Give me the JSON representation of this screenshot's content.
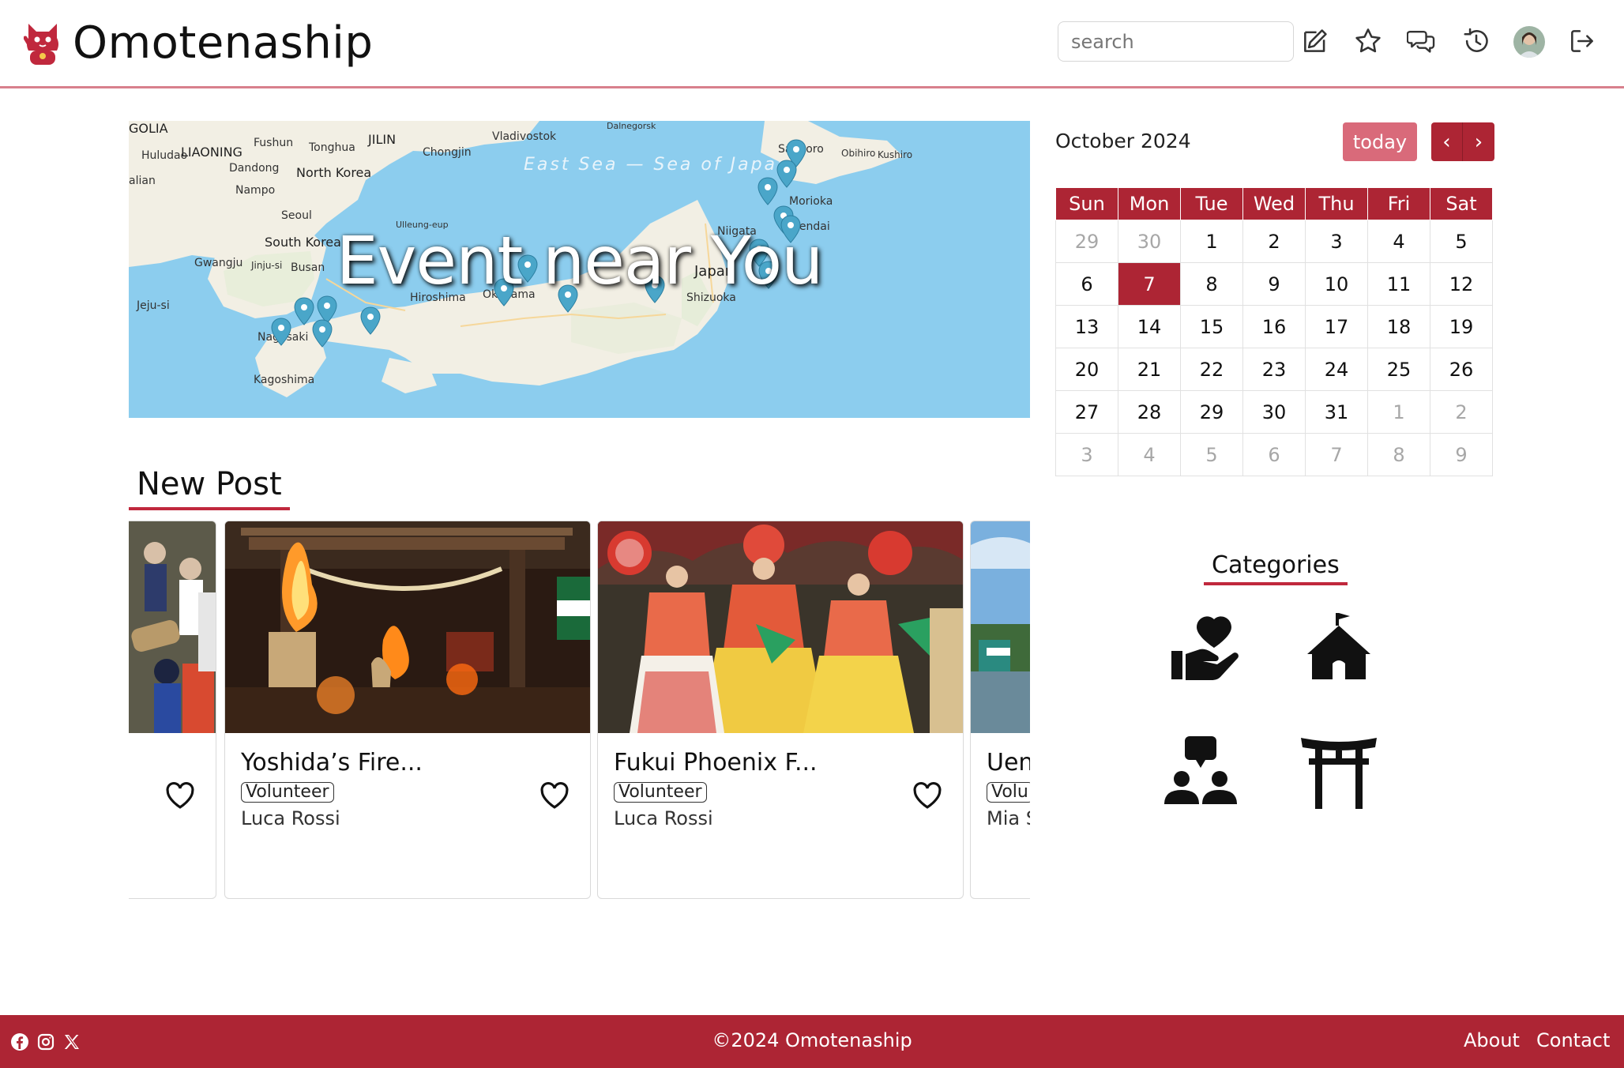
{
  "header": {
    "brand_name": "Omotenaship",
    "search_placeholder": "search",
    "icons": [
      "edit-icon",
      "star-icon",
      "chat-icon",
      "history-icon",
      "avatar",
      "logout-icon"
    ]
  },
  "map": {
    "title": "Event near You",
    "labels": [
      "GOLIA",
      "LIAONING",
      "JILIN",
      "Fushun",
      "Tonghua",
      "Vladivostok",
      "Huludao",
      "Dandong",
      "Chongjin",
      "Dalnegorsk",
      "North Korea",
      "Nampo",
      "Seoul",
      "Ulleung-eup",
      "South Korea",
      "Gwangju",
      "Jinju-si",
      "Busan",
      "Jeju-si",
      "Hiroshima",
      "Okayama",
      "Nagasaki",
      "Kagoshima",
      "Niigata",
      "Sendai",
      "Morioka",
      "Sapporo",
      "Obihiro",
      "Kushiro",
      "Shizuoka",
      "Japan",
      "alian"
    ],
    "sea_label": "East Sea — Sea of Japan"
  },
  "new_post": {
    "title": "New Post",
    "cards": [
      {
        "title": "",
        "tag": "",
        "author": ""
      },
      {
        "title": "Yoshida’s Fire...",
        "tag": "Volunteer",
        "author": "Luca Rossi"
      },
      {
        "title": "Fukui Phoenix F...",
        "tag": "Volunteer",
        "author": "Luca Rossi"
      },
      {
        "title": "Uen",
        "tag": "Volu",
        "author": "Mia S"
      }
    ]
  },
  "calendar": {
    "title": "October 2024",
    "today_label": "today",
    "prev_label": "‹",
    "next_label": "›",
    "weekdays": [
      "Sun",
      "Mon",
      "Tue",
      "Wed",
      "Thu",
      "Fri",
      "Sat"
    ],
    "weeks": [
      [
        "29",
        "30",
        "1",
        "2",
        "3",
        "4",
        "5"
      ],
      [
        "6",
        "7",
        "8",
        "9",
        "10",
        "11",
        "12"
      ],
      [
        "13",
        "14",
        "15",
        "16",
        "17",
        "18",
        "19"
      ],
      [
        "20",
        "21",
        "22",
        "23",
        "24",
        "25",
        "26"
      ],
      [
        "27",
        "28",
        "29",
        "30",
        "31",
        "1",
        "2"
      ],
      [
        "3",
        "4",
        "5",
        "6",
        "7",
        "8",
        "9"
      ]
    ],
    "selected_day": "7"
  },
  "categories": {
    "title": "Categories",
    "items": [
      "volunteer-icon",
      "school-icon",
      "community-icon",
      "shrine-icon"
    ]
  },
  "footer": {
    "copyright": "©2024 Omotenaship",
    "about": "About",
    "contact": "Contact",
    "social": [
      "facebook-icon",
      "instagram-icon",
      "x-icon"
    ]
  },
  "colors": {
    "accent": "#ad2534",
    "accent_light": "#d96a7a",
    "map_sea": "#8ccdee",
    "map_land": "#f2efe4",
    "marker": "#4aa6c9"
  }
}
